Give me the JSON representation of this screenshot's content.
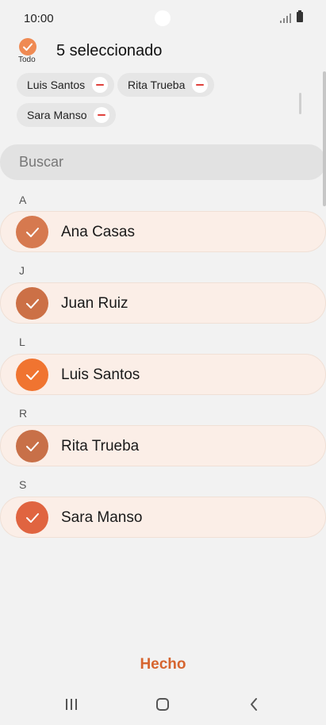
{
  "status_bar": {
    "time": "10:00",
    "signal_icon": "signal-icon",
    "battery_icon": "battery-icon"
  },
  "header": {
    "select_all_label": "Todo",
    "selected_count": "5 seleccionado",
    "accent_color": "#ef8a53"
  },
  "chips": [
    {
      "label": "Luis Santos"
    },
    {
      "label": "Rita Trueba"
    },
    {
      "label": "Sara Manso"
    }
  ],
  "search": {
    "placeholder": "Buscar"
  },
  "contacts": [
    {
      "section": "A",
      "name": "Ana Casas",
      "avatar_color": "#d6794f"
    },
    {
      "section": "J",
      "name": "Juan Ruiz",
      "avatar_color": "#cc7046"
    },
    {
      "section": "L",
      "name": "Luis Santos",
      "avatar_color": "#f07430"
    },
    {
      "section": "R",
      "name": "Rita Trueba",
      "avatar_color": "#c87048"
    },
    {
      "section": "S",
      "name": "Sara Manso",
      "avatar_color": "#e06440"
    }
  ],
  "footer": {
    "done_label": "Hecho",
    "done_color": "#d6652f"
  },
  "nav_bar": {
    "recents_icon": "recents-icon",
    "home_icon": "home-icon",
    "back_icon": "back-icon"
  }
}
